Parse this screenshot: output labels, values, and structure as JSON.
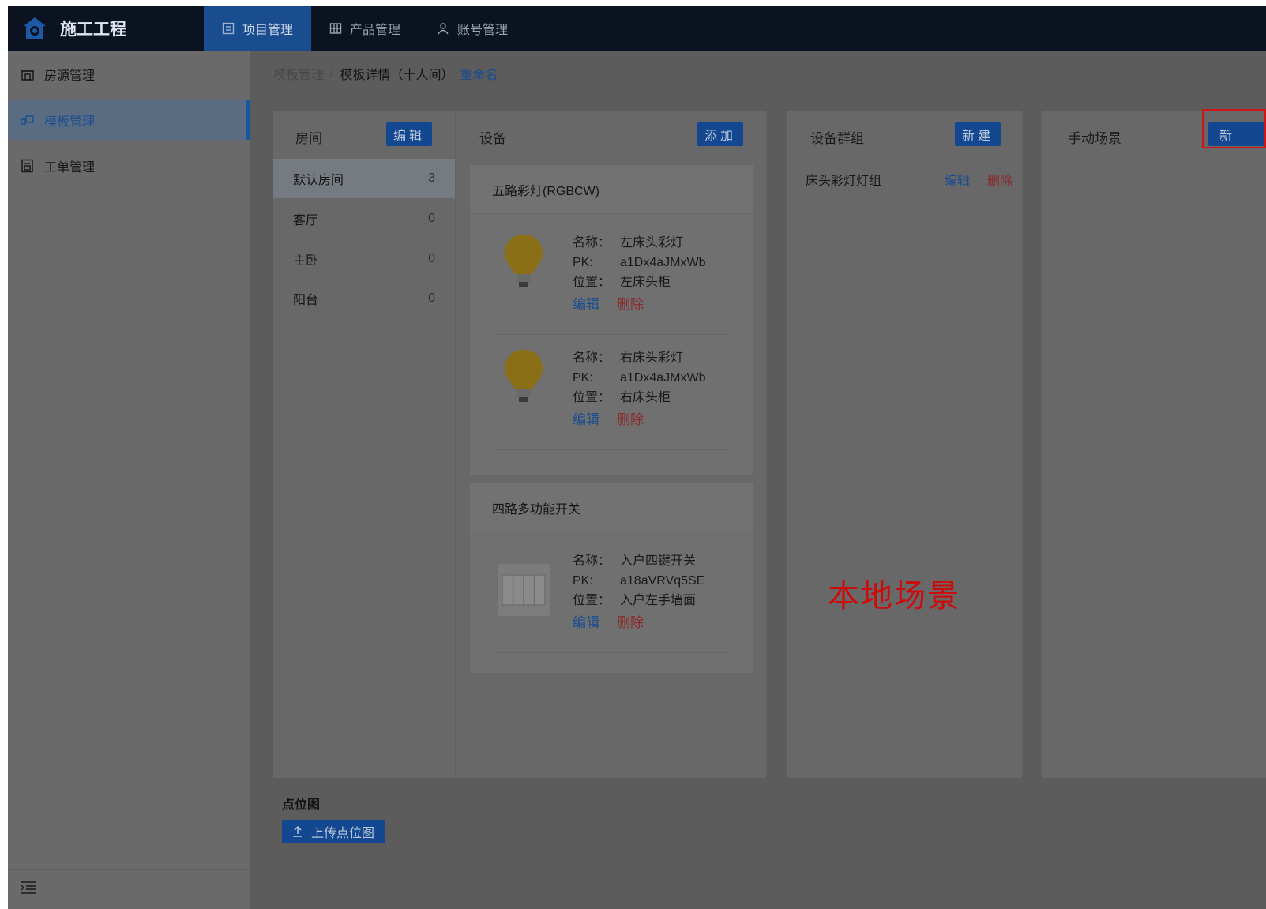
{
  "app": {
    "title": "施工工程"
  },
  "topnav": [
    {
      "label": "项目管理",
      "active": true
    },
    {
      "label": "产品管理",
      "active": false
    },
    {
      "label": "账号管理",
      "active": false
    }
  ],
  "sidebar": {
    "items": [
      {
        "label": "房源管理",
        "active": false
      },
      {
        "label": "模板管理",
        "active": true
      },
      {
        "label": "工单管理",
        "active": false
      }
    ]
  },
  "breadcrumb": {
    "parent": "模板管理",
    "separator": "/",
    "current": "模板详情（十人间）",
    "rename": "重命名"
  },
  "rooms": {
    "title": "房间",
    "edit_label": "编辑",
    "items": [
      {
        "name": "默认房间",
        "count": "3"
      },
      {
        "name": "客厅",
        "count": "0"
      },
      {
        "name": "主卧",
        "count": "0"
      },
      {
        "name": "阳台",
        "count": "0"
      }
    ]
  },
  "devices": {
    "title": "设备",
    "add_label": "添加",
    "groups": [
      {
        "type": "五路彩灯(RGBCW)",
        "items": [
          {
            "name": "左床头彩灯",
            "pk": "a1Dx4aJMxWb",
            "location": "左床头柜"
          },
          {
            "name": "右床头彩灯",
            "pk": "a1Dx4aJMxWb",
            "location": "右床头柜"
          }
        ]
      },
      {
        "type": "四路多功能开关",
        "items": [
          {
            "name": "入户四键开关",
            "pk": "a18aVRVq5SE",
            "location": "入户左手墙面"
          }
        ]
      }
    ],
    "labels": {
      "name": "名称：",
      "pk": "PK:",
      "location": "位置："
    },
    "edit_label": "编辑",
    "delete_label": "删除"
  },
  "device_groups": {
    "title": "设备群组",
    "new_label": "新建",
    "items": [
      {
        "name": "床头彩灯灯组",
        "edit": "编辑",
        "delete": "删除"
      }
    ]
  },
  "manual_scenes": {
    "title": "手动场景",
    "new_label": "新"
  },
  "annotation": {
    "text": "本地场景",
    "color": "#cc0b0b"
  },
  "pointmap": {
    "title": "点位图",
    "upload_label": "上传点位图"
  },
  "colors": {
    "topbar": "#0c1320",
    "accent": "#13478f",
    "danger": "#8a2a2a"
  },
  "icons": [
    "home-logo-icon",
    "project-icon",
    "product-grid-icon",
    "account-icon",
    "house-icon",
    "template-icon",
    "workorder-icon",
    "bulb-icon",
    "switch-icon",
    "upload-icon",
    "collapse-menu-icon"
  ]
}
